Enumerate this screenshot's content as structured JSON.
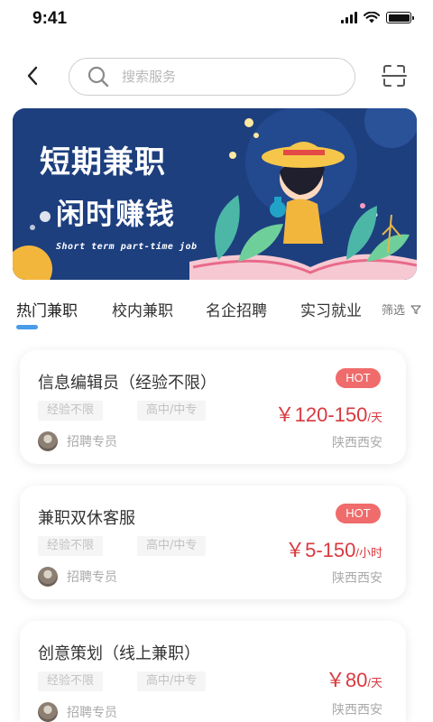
{
  "status_bar": {
    "time": "9:41"
  },
  "search": {
    "placeholder": "搜索服务"
  },
  "banner": {
    "line1": "短期兼职",
    "line2": "闲时赚钱",
    "subtitle": "Short term part-time job"
  },
  "tabs": [
    {
      "label": "热门兼职",
      "active": true
    },
    {
      "label": "校内兼职",
      "active": false
    },
    {
      "label": "名企招聘",
      "active": false
    },
    {
      "label": "实习就业",
      "active": false
    }
  ],
  "filter": {
    "label": "筛选"
  },
  "jobs": [
    {
      "title": "信息编辑员（经验不限）",
      "badge": "HOT",
      "tags": [
        "经验不限",
        "高中/中专"
      ],
      "salary_amount": "￥120-150",
      "salary_unit": "/天",
      "recruiter": "招聘专员",
      "location": "陕西西安"
    },
    {
      "title": "兼职双休客服",
      "badge": "HOT",
      "tags": [
        "经验不限",
        "高中/中专"
      ],
      "salary_amount": "￥5-150",
      "salary_unit": "/小时",
      "recruiter": "招聘专员",
      "location": "陕西西安"
    },
    {
      "title": "创意策划（线上兼职）",
      "badge": "",
      "tags": [
        "经验不限",
        "高中/中专"
      ],
      "salary_amount": "￥80",
      "salary_unit": "/天",
      "recruiter": "招聘专员",
      "location": "陕西西安"
    }
  ],
  "colors": {
    "accent": "#4a9be8",
    "hot": "#f06b6b",
    "salary": "#d9393f",
    "banner_bg": "#1d3f7e"
  },
  "icons": {
    "back": "chevron-left-icon",
    "search": "search-icon",
    "scan": "scan-icon",
    "filter": "filter-icon"
  }
}
